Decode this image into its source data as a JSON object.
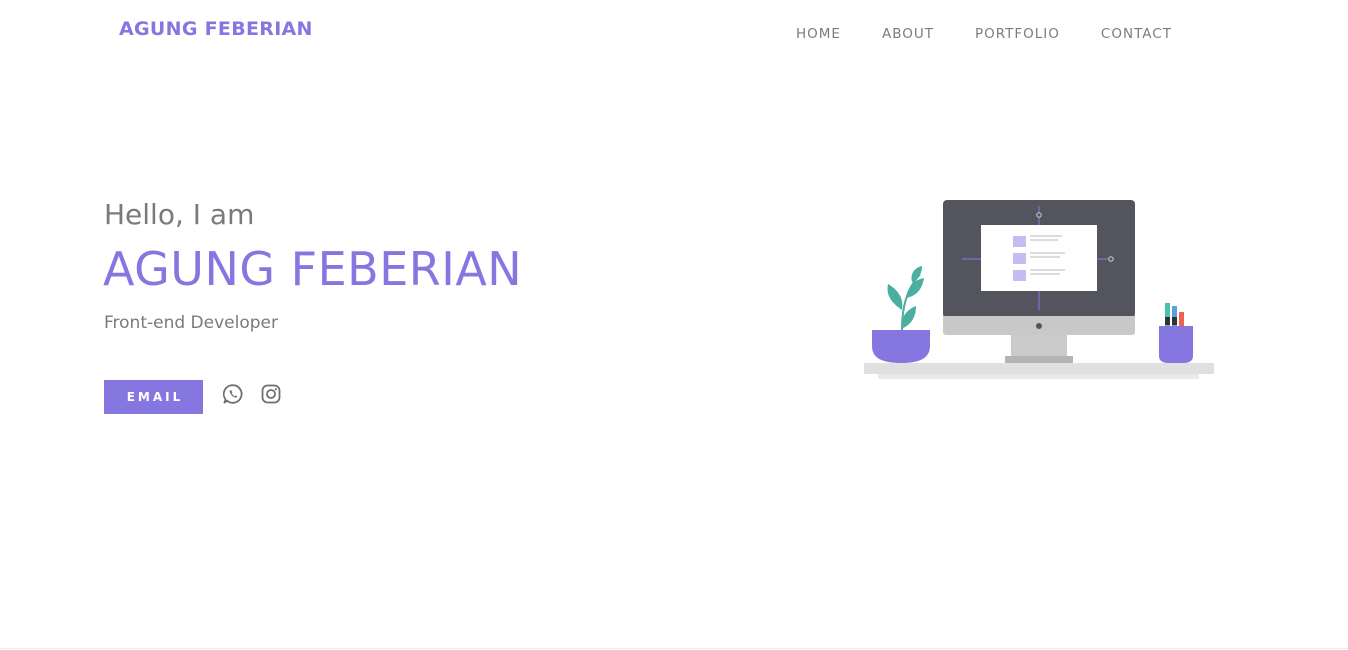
{
  "header": {
    "brand": "AGUNG FEBERIAN",
    "nav": [
      {
        "label": "HOME"
      },
      {
        "label": "ABOUT"
      },
      {
        "label": "PORTFOLIO"
      },
      {
        "label": "CONTACT"
      }
    ]
  },
  "hero": {
    "greeting": "Hello, I am",
    "name": "AGUNG FEBERIAN",
    "role": "Front-end Developer",
    "email_button": "EMAIL",
    "social": [
      {
        "icon": "whatsapp-icon"
      },
      {
        "icon": "instagram-icon"
      }
    ],
    "illustration": "desk-computer-illustration"
  },
  "colors": {
    "accent": "#8677e0",
    "text_muted": "#7a7a7a",
    "monitor_frame": "#54545f",
    "plant": "#4aaea0"
  }
}
